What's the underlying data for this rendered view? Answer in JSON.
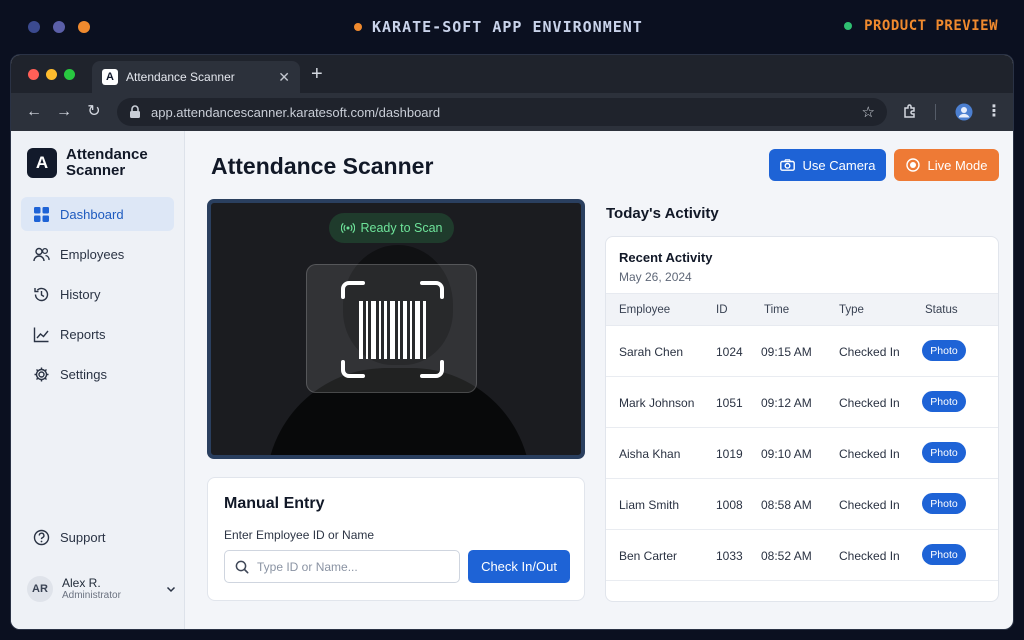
{
  "environment": {
    "title": "KARATE-SOFT APP ENVIRONMENT",
    "preview_label": "PRODUCT PREVIEW",
    "dot_colors": [
      "#3b4a8f",
      "#5b5fa8",
      "#f08a2e"
    ]
  },
  "browser": {
    "tab_title": "Attendance Scanner",
    "tab_favicon": "A",
    "url": "app.attendancescanner.karatesoft.com/dashboard"
  },
  "sidebar": {
    "logo_letter": "A",
    "app_name_line1": "Attendance",
    "app_name_line2": "Scanner",
    "items": [
      {
        "label": "Dashboard",
        "icon": "dashboard-icon",
        "active": true
      },
      {
        "label": "Employees",
        "icon": "users-icon",
        "active": false
      },
      {
        "label": "History",
        "icon": "history-icon",
        "active": false
      },
      {
        "label": "Reports",
        "icon": "reports-icon",
        "active": false
      },
      {
        "label": "Settings",
        "icon": "gear-icon",
        "active": false
      }
    ],
    "support_label": "Support",
    "user": {
      "initials": "AR",
      "name": "Alex R.",
      "role": "Administrator"
    }
  },
  "header": {
    "title": "Attendance Scanner",
    "use_camera_label": "Use Camera",
    "live_mode_label": "Live Mode"
  },
  "scanner": {
    "status_label": "Ready to Scan"
  },
  "manual_entry": {
    "title": "Manual Entry",
    "field_label": "Enter Employee ID or Name",
    "placeholder": "Type ID or Name...",
    "value": "",
    "button_label": "Check In/Out"
  },
  "activity": {
    "section_title": "Today's Activity",
    "card_title": "Recent Activity",
    "date": "May 26, 2024",
    "columns": [
      "Employee",
      "ID",
      "Time",
      "Type",
      "Status"
    ],
    "rows": [
      {
        "employee": "Sarah Chen",
        "id": "1024",
        "time": "09:15 AM",
        "type": "Checked In",
        "status": "Photo"
      },
      {
        "employee": "Mark Johnson",
        "id": "1051",
        "time": "09:12 AM",
        "type": "Checked In",
        "status": "Photo"
      },
      {
        "employee": "Aisha Khan",
        "id": "1019",
        "time": "09:10 AM",
        "type": "Checked In",
        "status": "Photo"
      },
      {
        "employee": "Liam Smith",
        "id": "1008",
        "time": "08:58 AM",
        "type": "Checked In",
        "status": "Photo"
      },
      {
        "employee": "Ben Carter",
        "id": "1033",
        "time": "08:52 AM",
        "type": "Checked In",
        "status": "Photo"
      }
    ]
  },
  "colors": {
    "primary": "#1e63d6",
    "accent_orange": "#ee7a35",
    "ready_green": "#6ee39a"
  }
}
